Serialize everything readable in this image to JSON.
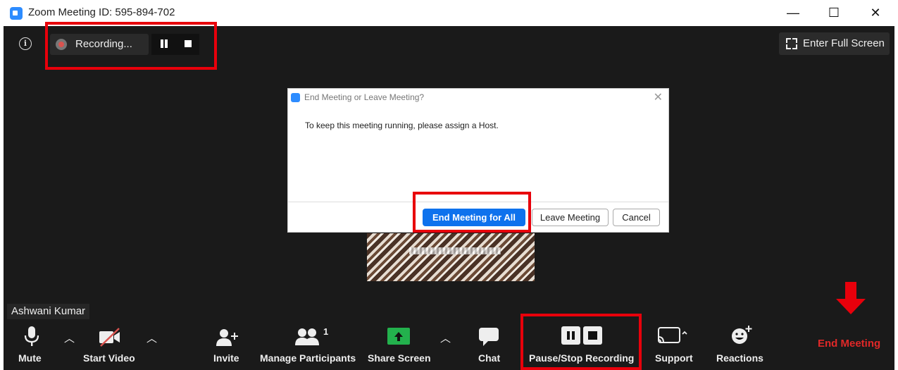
{
  "window": {
    "title": "Zoom Meeting ID: 595-894-702",
    "minimize": "—",
    "maximize": "☐",
    "close": "✕"
  },
  "recording": {
    "label": "Recording..."
  },
  "fullscreen": {
    "label": "Enter Full Screen"
  },
  "dialog": {
    "title": "End Meeting or Leave Meeting?",
    "message": "To keep this meeting running, please assign a Host.",
    "end_all": "End Meeting for All",
    "leave": "Leave Meeting",
    "cancel": "Cancel",
    "close": "✕"
  },
  "participant_name": "Ashwani Kumar",
  "toolbar": {
    "mute": "Mute",
    "start_video": "Start Video",
    "invite": "Invite",
    "manage_participants": "Manage Participants",
    "participant_count": "1",
    "share_screen": "Share Screen",
    "chat": "Chat",
    "pause_stop_recording": "Pause/Stop Recording",
    "support": "Support",
    "reactions": "Reactions",
    "end_meeting": "End Meeting"
  },
  "colors": {
    "accent": "#0e72ed",
    "annotation": "#e8000b",
    "end": "#e02828",
    "share": "#23b14d"
  }
}
